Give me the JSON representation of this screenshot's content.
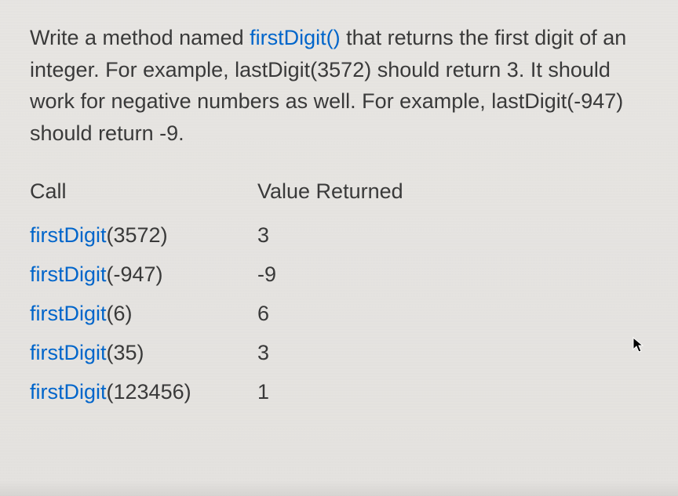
{
  "description": {
    "text_before_method": "Write a method named ",
    "method_name": "firstDigit()",
    "text_after_method": " that returns the first digit of an integer. For example, lastDigit(3572) should return 3. It should work for negative numbers as well. For example, lastDigit(-947) should return -9."
  },
  "table": {
    "headers": {
      "call": "Call",
      "value": "Value Returned"
    },
    "rows": [
      {
        "func": "firstDigit",
        "arg": "(3572)",
        "result": "3"
      },
      {
        "func": "firstDigit",
        "arg": "(-947)",
        "result": "-9"
      },
      {
        "func": "firstDigit",
        "arg": "(6)",
        "result": "6"
      },
      {
        "func": "firstDigit",
        "arg": "(35)",
        "result": "3"
      },
      {
        "func": "firstDigit",
        "arg": "(123456)",
        "result": "1"
      }
    ]
  }
}
